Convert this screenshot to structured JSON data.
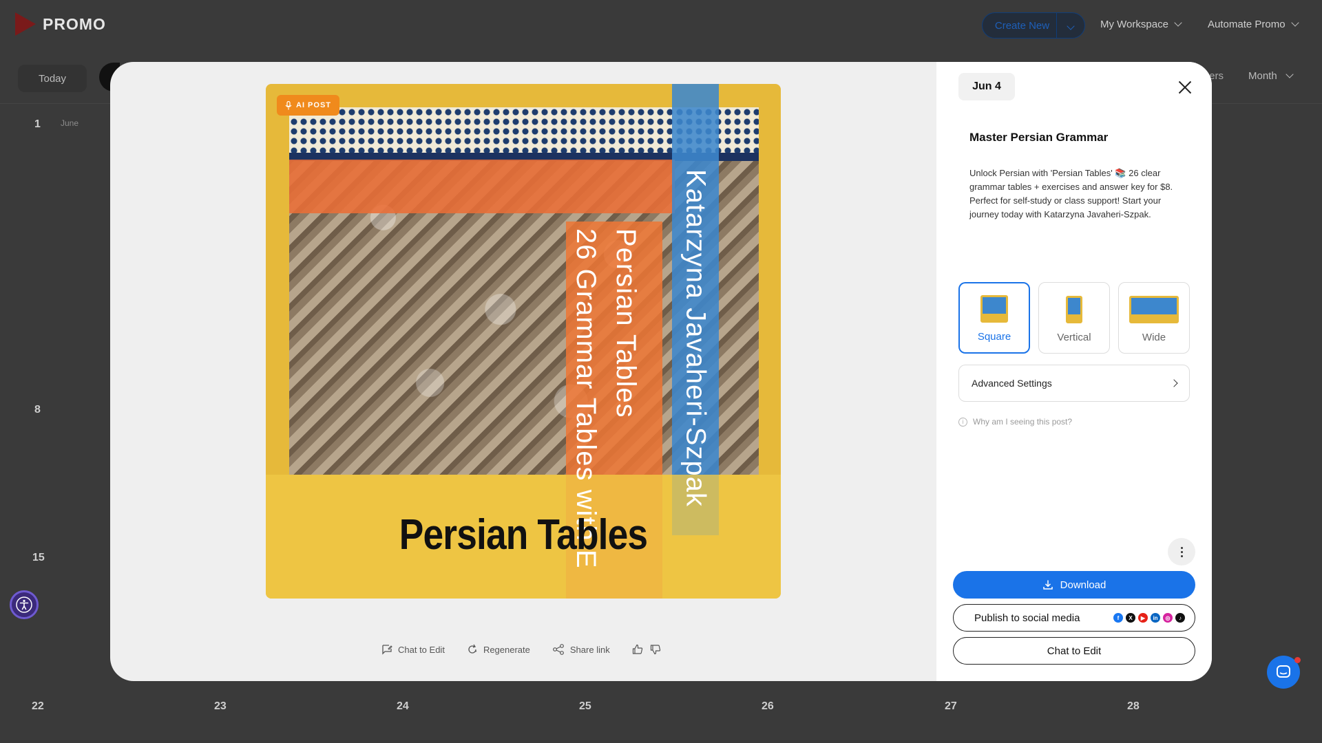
{
  "app": {
    "logo_text": "PROMO",
    "create_new": "Create New",
    "menu": [
      {
        "label": "My Workspace"
      },
      {
        "label": "Automate Promo"
      }
    ]
  },
  "calendar": {
    "today_label": "Today",
    "filters_label": "ters",
    "view_label": "Month",
    "month_caption": "June",
    "day_numbers": {
      "d1": "1",
      "d8": "8",
      "d15": "15",
      "d22": "22",
      "d23": "23",
      "d24": "24",
      "d25": "25",
      "d26": "26",
      "d27": "27",
      "d28": "28"
    }
  },
  "preview": {
    "badge": "AI POST",
    "author_vertical": "Katarzyna Javaheri-Szpak",
    "title_vertical": "Persian Tables",
    "subtitle_vertical": "26 Grammar Tables with E",
    "headline": "Persian Tables",
    "colors": {
      "yellow": "#e6b93a",
      "orange": "#eb6e37",
      "blue": "#3d87cd",
      "badge": "#f08a1c"
    }
  },
  "preview_actions": [
    {
      "label": "Chat to Edit",
      "icon": "chat-edit-icon"
    },
    {
      "label": "Regenerate",
      "icon": "regenerate-icon"
    },
    {
      "label": "Share link",
      "icon": "share-icon"
    }
  ],
  "panel": {
    "date": "Jun 4",
    "title": "Master Persian Grammar",
    "body": "Unlock Persian with 'Persian Tables' 📚 26 clear grammar tables + exercises and answer key for $8. Perfect for self-study or class support! Start your journey today with Katarzyna Javaheri-Szpak.",
    "formats": [
      {
        "label": "Square",
        "selected": true
      },
      {
        "label": "Vertical",
        "selected": false
      },
      {
        "label": "Wide",
        "selected": false
      }
    ],
    "advanced_settings": "Advanced Settings",
    "why_link": "Why am I seeing this post?",
    "download": "Download",
    "publish": "Publish to social media",
    "social_icons": [
      "facebook-icon",
      "x-icon",
      "youtube-icon",
      "linkedin-icon",
      "instagram-icon",
      "tiktok-icon"
    ],
    "chat_edit": "Chat to Edit",
    "accent_color": "#1a73e8"
  }
}
